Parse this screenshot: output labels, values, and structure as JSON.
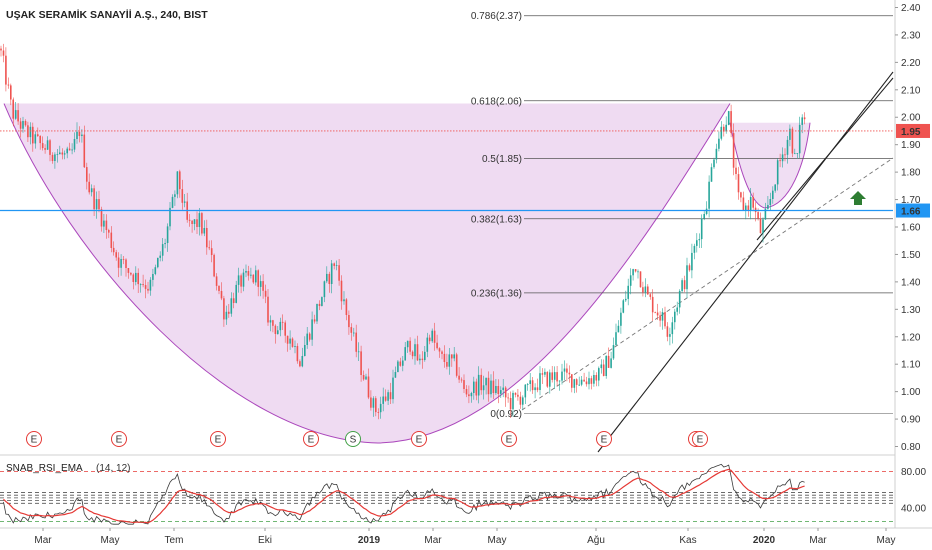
{
  "chart_data": {
    "type": "candlestick",
    "title": "UŞAK SERAMİK SANAYİİ A.Ş., 240, BIST",
    "price_axis": {
      "ylim": [
        0.78,
        2.42
      ],
      "ticks": [
        "2.40",
        "2.30",
        "2.20",
        "2.10",
        "2.00",
        "1.90",
        "1.80",
        "1.70",
        "1.60",
        "1.50",
        "1.40",
        "1.30",
        "1.20",
        "1.10",
        "1.00",
        "0.90",
        "0.80"
      ],
      "current_price": "1.95",
      "current_price_color": "#ef5350",
      "horizontal_level": "1.66",
      "horizontal_level_color": "#2196f3"
    },
    "time_axis": {
      "labels": [
        "Mar",
        "May",
        "Tem",
        "Eki",
        "2019",
        "Mar",
        "May",
        "Ağu",
        "Kas",
        "2020",
        "Mar",
        "May"
      ],
      "bold_labels": [
        "2019",
        "2020"
      ]
    },
    "fibonacci": [
      {
        "label": "0.786(2.37)",
        "value": 2.37
      },
      {
        "label": "0.618(2.06)",
        "value": 2.06
      },
      {
        "label": "0.5(1.85)",
        "value": 1.85
      },
      {
        "label": "0.382(1.63)",
        "value": 1.63
      },
      {
        "label": "0.236(1.36)",
        "value": 1.36
      },
      {
        "label": "0(0.92)",
        "value": 0.92
      }
    ],
    "price_anchors": [
      [
        0,
        2.25
      ],
      [
        4,
        2.18
      ],
      [
        12,
        2.02
      ],
      [
        25,
        1.95
      ],
      [
        40,
        1.9
      ],
      [
        55,
        1.87
      ],
      [
        70,
        1.85
      ],
      [
        80,
        1.96
      ],
      [
        88,
        1.75
      ],
      [
        100,
        1.65
      ],
      [
        118,
        1.48
      ],
      [
        135,
        1.42
      ],
      [
        150,
        1.38
      ],
      [
        165,
        1.55
      ],
      [
        178,
        1.78
      ],
      [
        188,
        1.6
      ],
      [
        200,
        1.62
      ],
      [
        210,
        1.5
      ],
      [
        225,
        1.28
      ],
      [
        240,
        1.4
      ],
      [
        258,
        1.42
      ],
      [
        270,
        1.25
      ],
      [
        290,
        1.2
      ],
      [
        300,
        1.12
      ],
      [
        315,
        1.28
      ],
      [
        335,
        1.48
      ],
      [
        345,
        1.3
      ],
      [
        360,
        1.1
      ],
      [
        375,
        0.93
      ],
      [
        390,
        1.0
      ],
      [
        400,
        1.1
      ],
      [
        410,
        1.18
      ],
      [
        420,
        1.1
      ],
      [
        430,
        1.22
      ],
      [
        440,
        1.12
      ],
      [
        455,
        1.1
      ],
      [
        465,
        0.99
      ],
      [
        480,
        1.03
      ],
      [
        500,
        1.0
      ],
      [
        510,
        0.96
      ],
      [
        520,
        0.98
      ],
      [
        540,
        1.04
      ],
      [
        560,
        1.06
      ],
      [
        580,
        1.04
      ],
      [
        600,
        1.06
      ],
      [
        612,
        1.14
      ],
      [
        622,
        1.3
      ],
      [
        635,
        1.47
      ],
      [
        648,
        1.34
      ],
      [
        662,
        1.27
      ],
      [
        668,
        1.22
      ],
      [
        680,
        1.36
      ],
      [
        690,
        1.46
      ],
      [
        700,
        1.6
      ],
      [
        708,
        1.72
      ],
      [
        715,
        1.9
      ],
      [
        722,
        1.96
      ],
      [
        728,
        2.02
      ],
      [
        733,
        1.85
      ],
      [
        738,
        1.7
      ],
      [
        745,
        1.67
      ],
      [
        752,
        1.7
      ],
      [
        760,
        1.58
      ],
      [
        768,
        1.66
      ],
      [
        775,
        1.78
      ],
      [
        782,
        1.86
      ],
      [
        790,
        1.95
      ],
      [
        796,
        1.82
      ],
      [
        802,
        2.02
      ],
      [
        806,
        1.96
      ]
    ],
    "rsi": {
      "name": "SNAB_RSI_EMA",
      "params": "(14, 12)",
      "ylim": [
        20,
        95
      ],
      "ticks": [
        "80.00",
        "40.00"
      ],
      "levels": [
        {
          "value": 80,
          "color": "#e53935"
        },
        {
          "value": 57,
          "color": "#555555"
        },
        {
          "value": 54,
          "color": "#555555"
        },
        {
          "value": 51,
          "color": "#555555"
        },
        {
          "value": 48,
          "color": "#555555"
        },
        {
          "value": 45,
          "color": "#555555"
        },
        {
          "value": 25,
          "color": "#43a047"
        }
      ]
    },
    "events": {
      "earnings_marker": "E",
      "split_marker": "S"
    },
    "pattern": "cup-and-handle",
    "colors": {
      "up": "#26a69a",
      "down": "#ef5350",
      "cup_fill": "#e1bee7",
      "cup_stroke": "#ab47bc",
      "arrow": "#2e7d32",
      "rsi_line": "#3a3a3a",
      "rsi_ema": "#e53935"
    }
  }
}
